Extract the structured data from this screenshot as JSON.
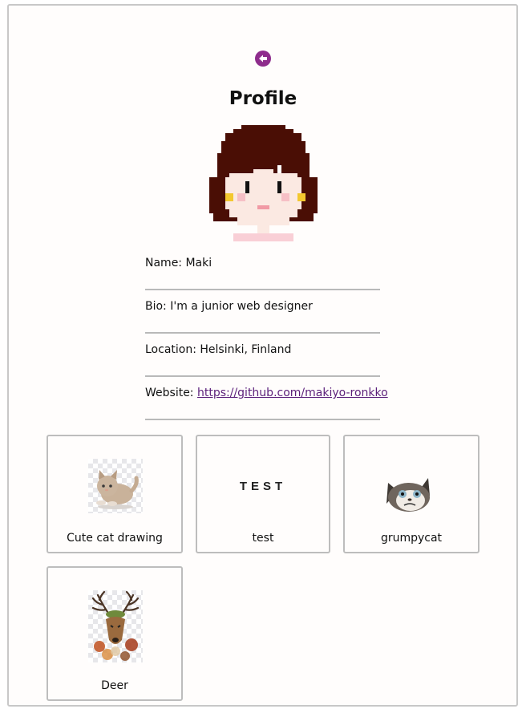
{
  "page": {
    "title": "Profile",
    "back_icon": "arrow-left-circle-icon",
    "accent_color": "#8e2c8c"
  },
  "profile": {
    "avatar_icon": "pixel-girl-avatar",
    "name_line": "Name: Maki",
    "bio_line": "Bio: I'm a junior web designer",
    "location_line": "Location: Helsinki, Finland",
    "website_prefix": "Website: ",
    "website_url": "https://github.com/makiyo-ronkko"
  },
  "gallery": [
    {
      "label": "Cute cat drawing",
      "image": "kitten-image"
    },
    {
      "label": "test",
      "image": "test-text-image",
      "image_text": "TEST"
    },
    {
      "label": "grumpycat",
      "image": "grumpy-cat-image"
    },
    {
      "label": "Deer",
      "image": "deer-image"
    }
  ]
}
